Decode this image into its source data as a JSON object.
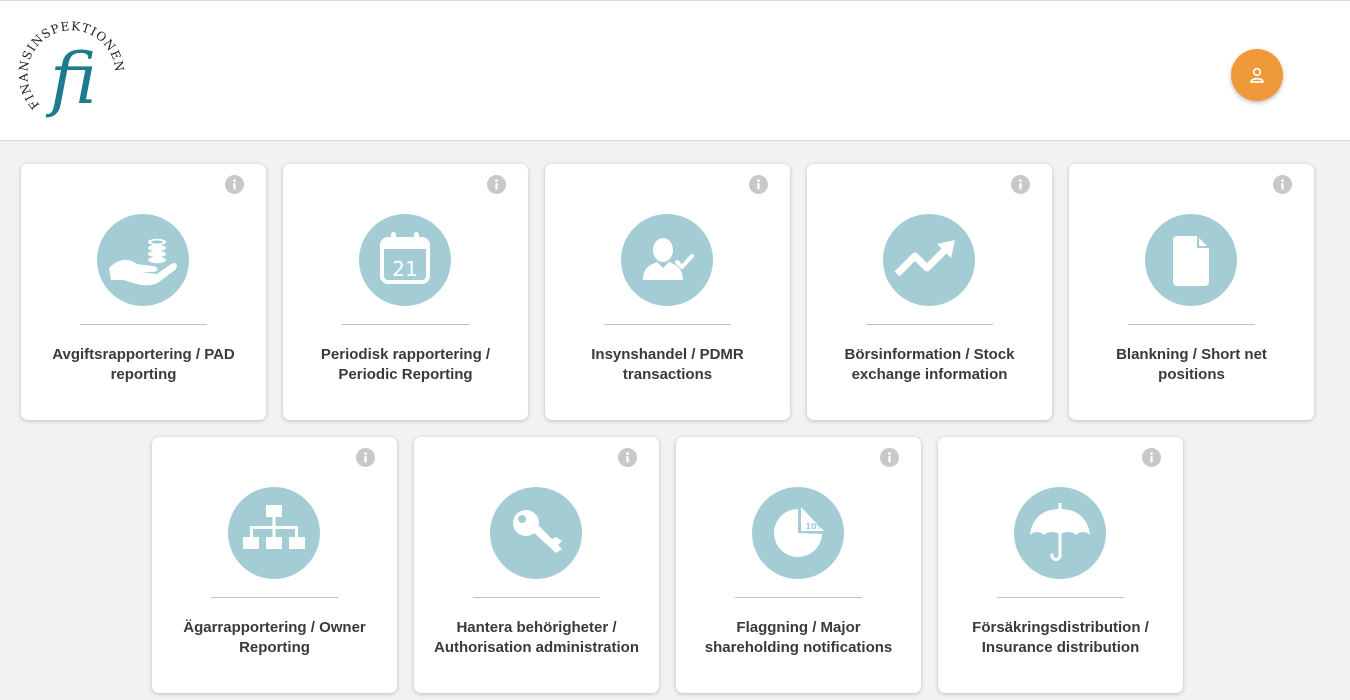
{
  "header": {
    "logo": {
      "ring_text": "FINANSINSPEKTIONEN",
      "monogram": "fi",
      "color": "#1d7c8c"
    },
    "user_button": {
      "icon": "user-icon",
      "color": "#f0993a"
    }
  },
  "theme": {
    "icon_circle": "#a3ccd5",
    "info_icon": "#c8c8c8"
  },
  "services": [
    {
      "label": "Avgiftsrapportering / PAD reporting",
      "icon": "hand-coins-icon"
    },
    {
      "label": "Periodisk rapportering / Periodic Reporting",
      "icon": "calendar-icon",
      "icon_text": "21"
    },
    {
      "label": "Insynshandel / PDMR transactions",
      "icon": "user-check-icon"
    },
    {
      "label": "Börsinformation / Stock exchange information",
      "icon": "trending-up-icon"
    },
    {
      "label": "Blankning / Short net positions",
      "icon": "document-icon"
    },
    {
      "label": "Ägarrapportering / Owner Reporting",
      "icon": "org-chart-icon"
    },
    {
      "label": "Hantera behörigheter / Authorisation administration",
      "icon": "key-icon"
    },
    {
      "label": "Flaggning / Major shareholding notifications",
      "icon": "pie-chart-icon",
      "icon_text": "10%"
    },
    {
      "label": "Försäkringsdistribution / Insurance distribution",
      "icon": "umbrella-icon"
    }
  ]
}
